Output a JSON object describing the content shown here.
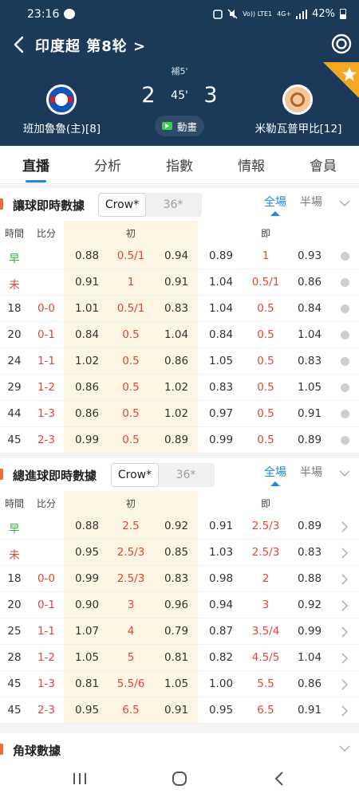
{
  "status_bar": {
    "time": "23:16",
    "volte": "Vo)) LTE1",
    "net": "4G+",
    "battery": "42%"
  },
  "header": {
    "league": "印度超 第8轮 >",
    "extra_time": "補5'",
    "home_team": "班加魯魯(主)[8]",
    "away_team": "米勒瓦普甲比[12]",
    "home_score": "2",
    "away_score": "3",
    "minute": "45'",
    "animation_label": "動畫"
  },
  "tabs": [
    "直播",
    "分析",
    "指數",
    "情報",
    "會員"
  ],
  "colors": {
    "header_bg": "#1b3a5a",
    "accent": "#1f86e8",
    "red": "#e0453a",
    "green": "#2db53a",
    "highlight": "#fdf5e3",
    "section_bar": "#f26a3c"
  },
  "handicap": {
    "title": "讓球即時數據",
    "source_active": "Crow*",
    "source_other": "36*",
    "scope_full": "全場",
    "scope_half": "半場",
    "headers": {
      "time": "時間",
      "score": "比分",
      "initial": "初",
      "current": "即"
    },
    "rows": [
      {
        "time": "早",
        "score": "",
        "v1": "0.88",
        "h1": "0.5/1",
        "v2": "0.94",
        "v3": "0.89",
        "h2": "1",
        "v4": "0.93"
      },
      {
        "time": "未",
        "score": "",
        "v1": "0.91",
        "h1": "1",
        "v2": "0.91",
        "v3": "1.04",
        "h2": "0.5/1",
        "v4": "0.86"
      },
      {
        "time": "18",
        "score": "0-0",
        "v1": "1.01",
        "h1": "0.5/1",
        "v2": "0.83",
        "v3": "1.04",
        "h2": "0.5",
        "v4": "0.84"
      },
      {
        "time": "20",
        "score": "0-1",
        "v1": "0.84",
        "h1": "0.5",
        "v2": "1.04",
        "v3": "0.84",
        "h2": "0.5",
        "v4": "1.04"
      },
      {
        "time": "24",
        "score": "1-1",
        "v1": "1.02",
        "h1": "0.5",
        "v2": "0.86",
        "v3": "1.05",
        "h2": "0.5",
        "v4": "0.83"
      },
      {
        "time": "29",
        "score": "1-2",
        "v1": "0.86",
        "h1": "0.5",
        "v2": "1.02",
        "v3": "0.83",
        "h2": "0.5",
        "v4": "1.05"
      },
      {
        "time": "44",
        "score": "1-3",
        "v1": "0.86",
        "h1": "0.5",
        "v2": "1.02",
        "v3": "0.97",
        "h2": "0.5",
        "v4": "0.91"
      },
      {
        "time": "45",
        "score": "2-3",
        "v1": "0.99",
        "h1": "0.5",
        "v2": "0.89",
        "v3": "0.99",
        "h2": "0.5",
        "v4": "0.89"
      }
    ]
  },
  "totals": {
    "title": "總進球即時數據",
    "source_active": "Crow*",
    "source_other": "36*",
    "scope_full": "全場",
    "scope_half": "半場",
    "headers": {
      "time": "時間",
      "score": "比分",
      "initial": "初",
      "current": "即"
    },
    "rows": [
      {
        "time": "早",
        "score": "",
        "v1": "0.88",
        "h1": "2.5",
        "v2": "0.92",
        "v3": "0.91",
        "h2": "2.5/3",
        "v4": "0.89"
      },
      {
        "time": "未",
        "score": "",
        "v1": "0.95",
        "h1": "2.5/3",
        "v2": "0.85",
        "v3": "1.03",
        "h2": "2.5/3",
        "v4": "0.83"
      },
      {
        "time": "18",
        "score": "0-0",
        "v1": "0.99",
        "h1": "2.5/3",
        "v2": "0.83",
        "v3": "0.98",
        "h2": "2",
        "v4": "0.88"
      },
      {
        "time": "20",
        "score": "0-1",
        "v1": "0.90",
        "h1": "3",
        "v2": "0.96",
        "v3": "0.94",
        "h2": "3",
        "v4": "0.92"
      },
      {
        "time": "25",
        "score": "1-1",
        "v1": "1.07",
        "h1": "4",
        "v2": "0.79",
        "v3": "0.87",
        "h2": "3.5/4",
        "v4": "0.99"
      },
      {
        "time": "28",
        "score": "1-2",
        "v1": "1.05",
        "h1": "5",
        "v2": "0.81",
        "v3": "0.82",
        "h2": "4.5/5",
        "v4": "1.04"
      },
      {
        "time": "45",
        "score": "1-3",
        "v1": "0.81",
        "h1": "5.5/6",
        "v2": "1.05",
        "v3": "1.00",
        "h2": "5.5",
        "v4": "0.86"
      },
      {
        "time": "45",
        "score": "2-3",
        "v1": "0.95",
        "h1": "6.5",
        "v2": "0.91",
        "v3": "0.95",
        "h2": "6.5",
        "v4": "0.91"
      }
    ]
  },
  "corners": {
    "title": "角球數據"
  }
}
